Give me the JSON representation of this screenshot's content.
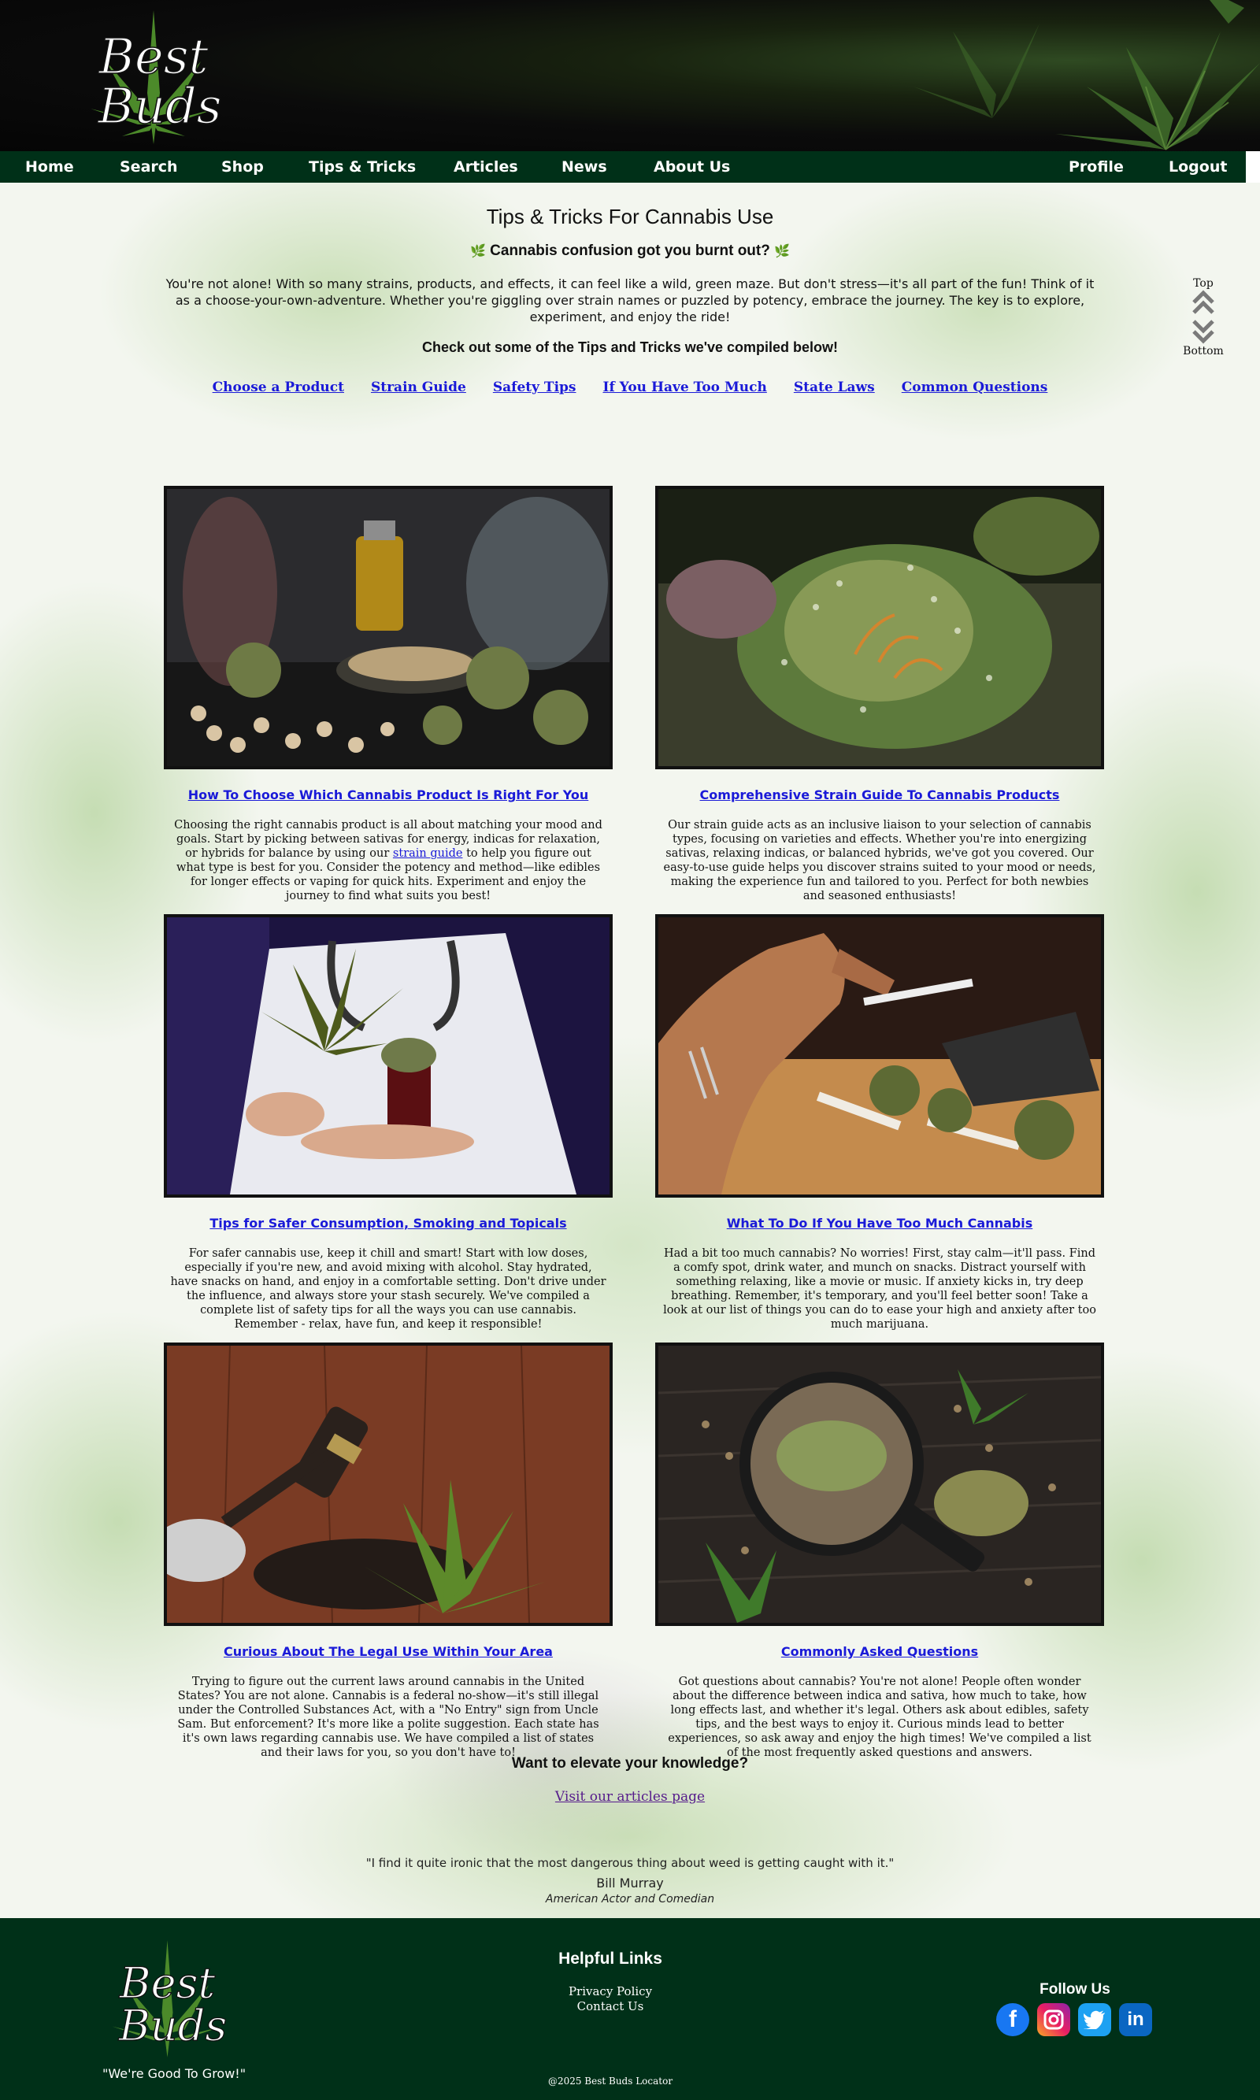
{
  "brand": {
    "logo_text_top": "Best",
    "logo_text_bottom": "Buds"
  },
  "nav": {
    "left": [
      "Home",
      "Search",
      "Shop",
      "Tips & Tricks",
      "Articles",
      "News",
      "About Us"
    ],
    "right": [
      "Profile",
      "Logout"
    ]
  },
  "hero": {
    "title": "Tips & Tricks For Cannabis Use",
    "subtitle": "Cannabis confusion got you burnt out?",
    "intro": "You're not alone! With so many strains, products, and effects, it can feel like a wild, green maze. But don't stress—it's all part of the fun! Think of it as a choose-your-own-adventure. Whether you're giggling over strain names or puzzled by potency, embrace the journey. The key is to explore, experiment, and enjoy the ride!",
    "checkout": "Check out some of the Tips and Tricks we've compiled below!"
  },
  "quick_links": [
    "Choose a Product",
    "Strain Guide",
    "Safety Tips",
    "If You Have Too Much",
    "State Laws",
    "Common Questions"
  ],
  "scroll": {
    "top": "Top",
    "bottom": "Bottom"
  },
  "cards": [
    {
      "title": "How To Choose Which Cannabis Product Is Right For You",
      "desc_before": "Choosing the right cannabis product is all about matching your mood and goals. Start by picking between sativas for energy, indicas for relaxation, or hybrids for balance by using our ",
      "desc_link": "strain guide",
      "desc_after": " to help you figure out what type is best for you. Consider the potency and method—like edibles for longer effects or vaping for quick hits. Experiment and enjoy the journey to find what suits you best!"
    },
    {
      "title": "Comprehensive Strain Guide To Cannabis Products",
      "desc": "Our strain guide acts as an inclusive liaison to your selection of cannabis types, focusing on varieties and effects. Whether you're into energizing sativas, relaxing indicas, or balanced hybrids, we've got you covered. Our easy-to-use guide helps you discover strains suited to your mood or needs, making the experience fun and tailored to you. Perfect for both newbies and seasoned enthusiasts!"
    },
    {
      "title": "Tips for Safer Consumption, Smoking and Topicals",
      "desc": "For safer cannabis use, keep it chill and smart! Start with low doses, especially if you're new, and avoid mixing with alcohol. Stay hydrated, have snacks on hand, and enjoy in a comfortable setting. Don't drive under the influence, and always store your stash securely. We've compiled a complete list of safety tips for all the ways you can use cannabis. Remember - relax, have fun, and keep it responsible!"
    },
    {
      "title": "What To Do If You Have Too Much Cannabis",
      "desc": "Had a bit too much cannabis? No worries! First, stay calm—it'll pass. Find a comfy spot, drink water, and munch on snacks. Distract yourself with something relaxing, like a movie or music. If anxiety kicks in, try deep breathing. Remember, it's temporary, and you'll feel better soon! Take a look at our list of things you can do to ease your high and anxiety after too much marijuana."
    },
    {
      "title": "Curious About The Legal Use Within Your Area",
      "desc": "Trying to figure out the current laws around cannabis in the United States? You are not alone. Cannabis is a federal no-show—it's still illegal under the Controlled Substances Act, with a \"No Entry\" sign from Uncle Sam. But enforcement? It's more like a polite suggestion. Each state has it's own laws regarding cannabis use. We have compiled a list of states and their laws for you, so you don't have to!"
    },
    {
      "title": "Commonly Asked Questions",
      "desc": "Got questions about cannabis? You're not alone! People often wonder about the difference between indica and sativa, how much to take, how long effects last, and whether it's legal. Others ask about edibles, safety tips, and the best ways to enjoy it. Curious minds lead to better experiences, so ask away and enjoy the high times! We've compiled a list of the most frequently asked questions and answers."
    }
  ],
  "elevate": {
    "heading": "Want to elevate your knowledge?",
    "link": "Visit our articles page"
  },
  "quote": {
    "text": "\"I find it quite ironic that the most dangerous thing about weed is getting caught with it.\"",
    "author": "Bill Murray",
    "role": "American Actor and Comedian"
  },
  "footer": {
    "slogan": "\"We're Good To Grow!\"",
    "helpful_heading": "Helpful Links",
    "links": [
      "Privacy Policy",
      "Contact Us"
    ],
    "follow_heading": "Follow Us",
    "socials": [
      "facebook-icon",
      "instagram-icon",
      "twitter-icon",
      "linkedin-icon"
    ],
    "copyright": "@2025 Best Buds Locator"
  },
  "colors": {
    "nav_bg": "#003018",
    "link_blue": "#1a1ad8",
    "visited": "#551a8b",
    "leaf_green": "#4c8a2a"
  }
}
